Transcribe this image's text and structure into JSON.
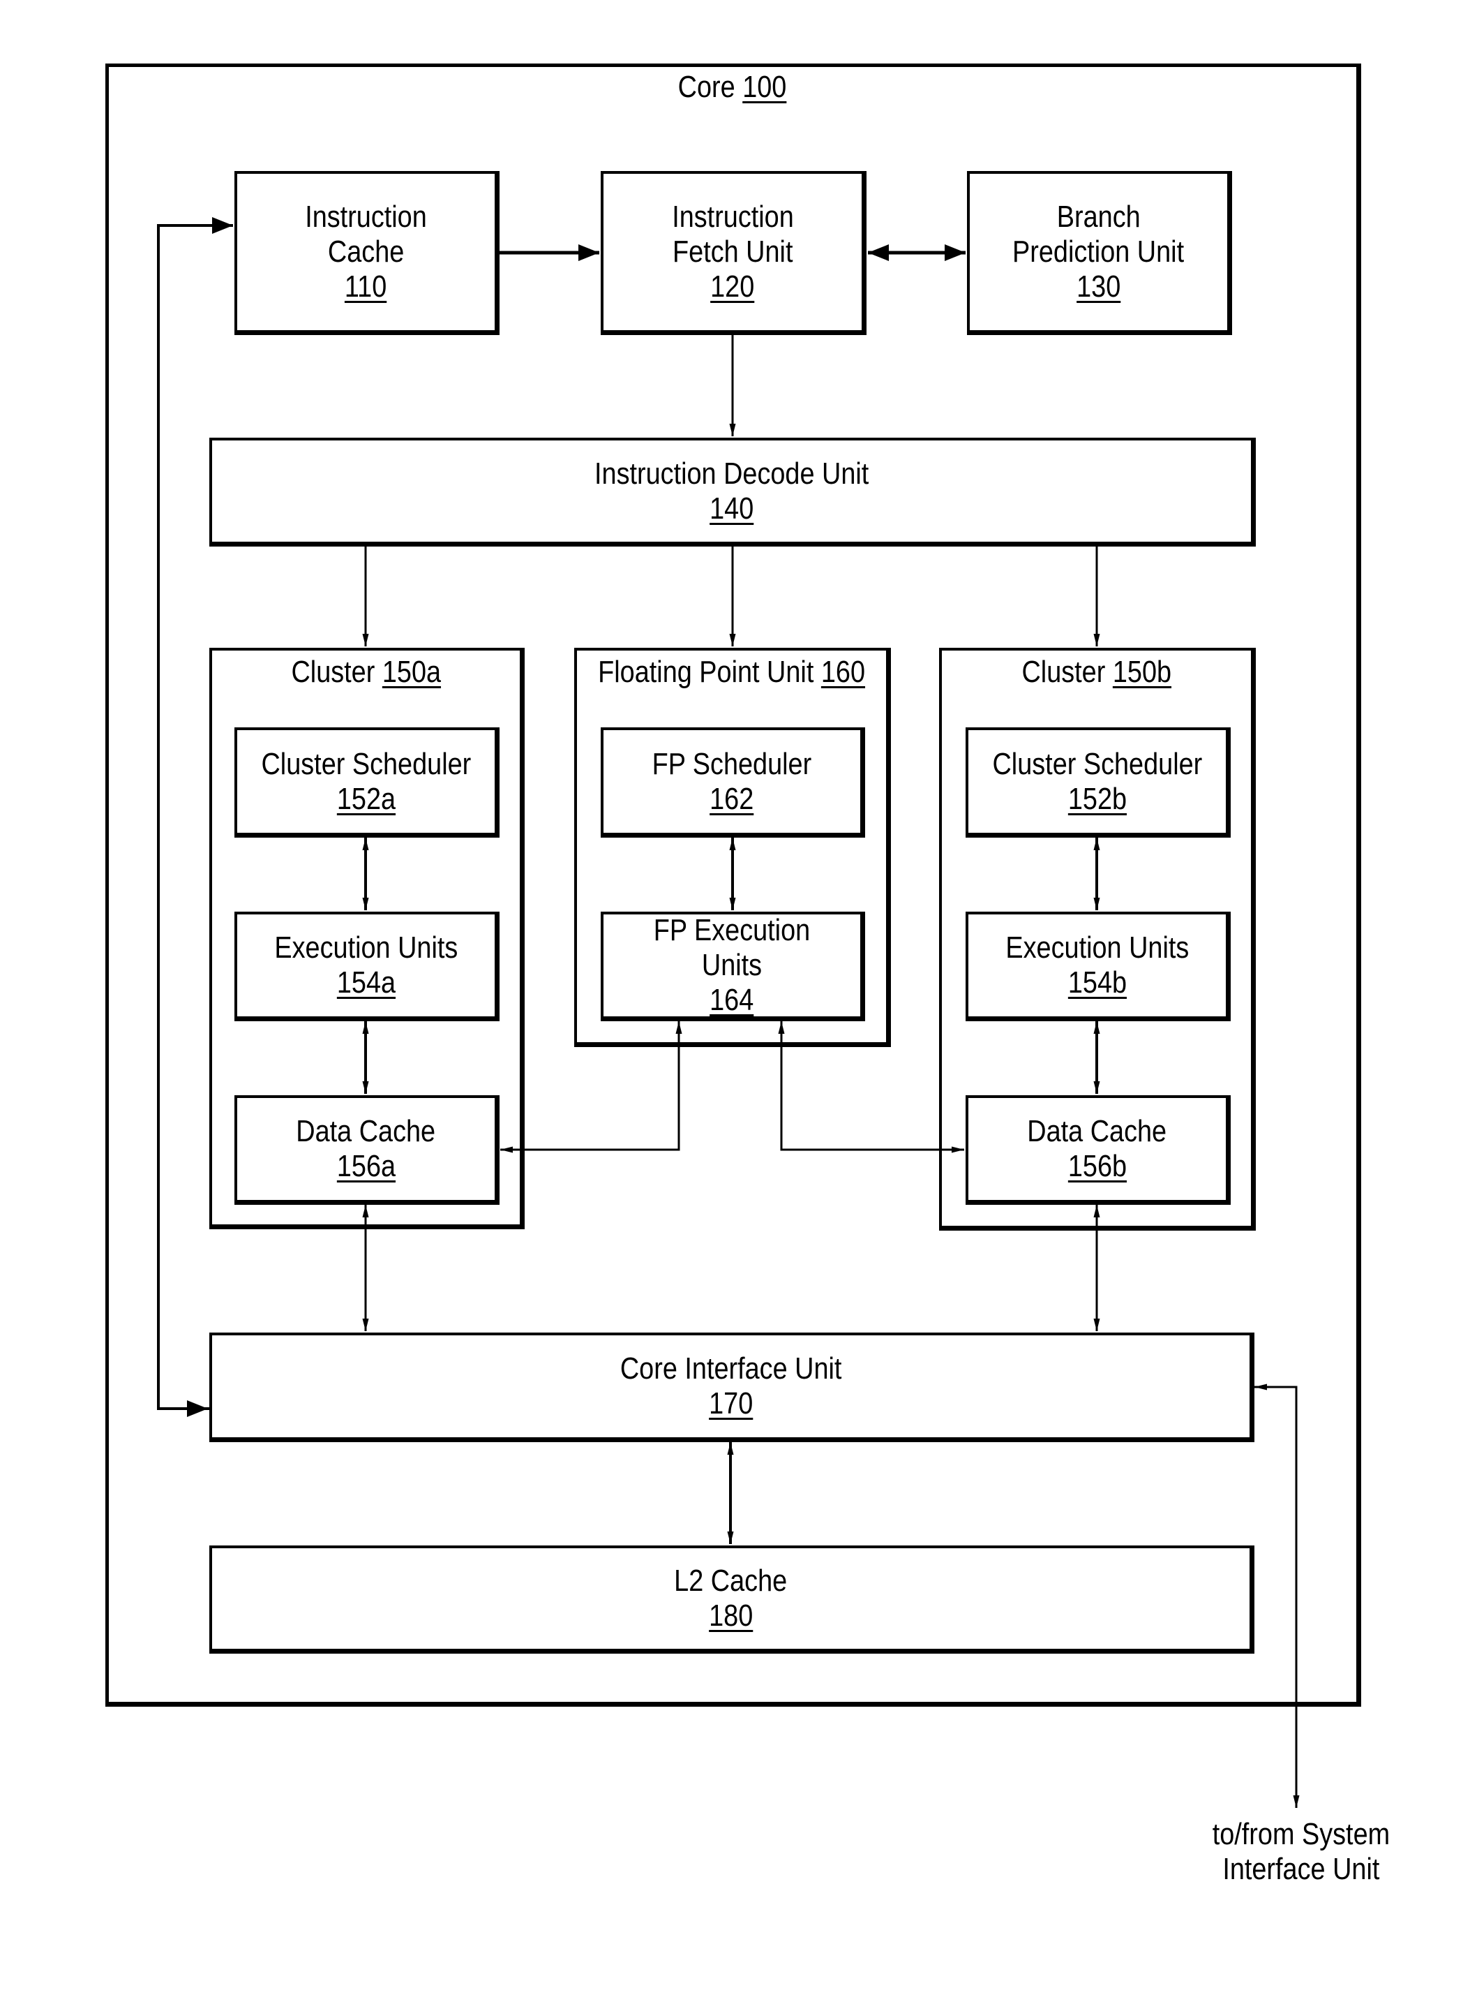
{
  "core": {
    "name": "Core",
    "ref": "100"
  },
  "top_row": [
    {
      "id": "icache",
      "lines": [
        "Instruction",
        "Cache"
      ],
      "ref": "110"
    },
    {
      "id": "ifu",
      "lines": [
        "Instruction",
        "Fetch Unit"
      ],
      "ref": "120"
    },
    {
      "id": "bpu",
      "lines": [
        "Branch",
        "Prediction Unit"
      ],
      "ref": "130"
    }
  ],
  "decode": {
    "name": "Instruction Decode Unit",
    "ref": "140"
  },
  "cluster_a": {
    "name": "Cluster",
    "ref": "150a",
    "scheduler": {
      "name": "Cluster Scheduler",
      "ref": "152a"
    },
    "execution": {
      "name": "Execution Units",
      "ref": "154a"
    },
    "data_cache": {
      "name": "Data Cache",
      "ref": "156a"
    }
  },
  "fpu": {
    "name": "Floating Point Unit",
    "ref": "160",
    "scheduler": {
      "name": "FP Scheduler",
      "ref": "162"
    },
    "execution": {
      "name": "FP Execution Units",
      "ref": "164"
    }
  },
  "cluster_b": {
    "name": "Cluster",
    "ref": "150b",
    "scheduler": {
      "name": "Cluster Scheduler",
      "ref": "152b"
    },
    "execution": {
      "name": "Execution Units",
      "ref": "154b"
    },
    "data_cache": {
      "name": "Data Cache",
      "ref": "156b"
    }
  },
  "core_interface": {
    "name": "Core Interface Unit",
    "ref": "170"
  },
  "l2": {
    "name": "L2 Cache",
    "ref": "180"
  },
  "external": {
    "lines": [
      "to/from System",
      "Interface Unit"
    ]
  }
}
